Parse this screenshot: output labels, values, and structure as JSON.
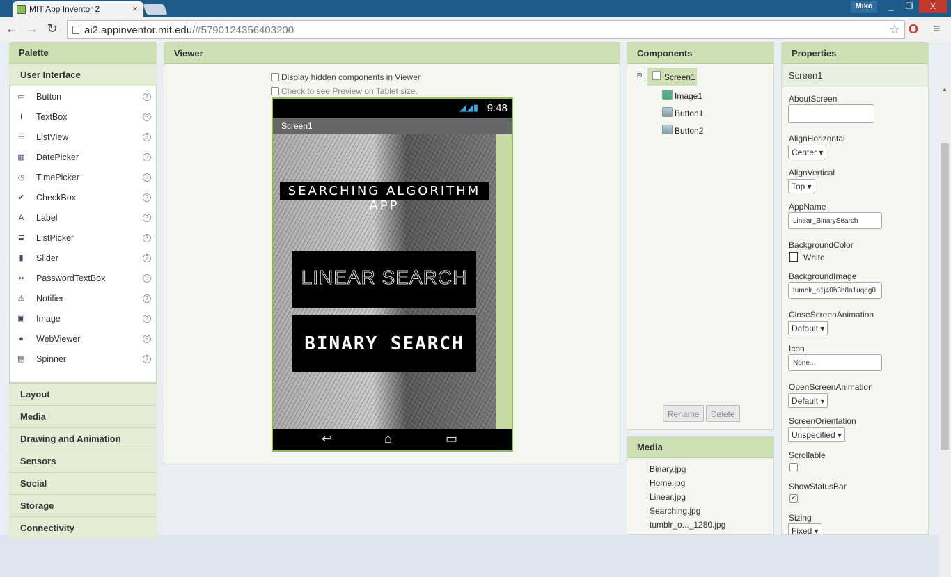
{
  "browser": {
    "tab_title": "MIT App Inventor 2",
    "tab_close": "×",
    "user": "Miko",
    "minimize": "_",
    "restore": "❐",
    "close": "X",
    "url_host": "ai2.appinventor.mit.edu",
    "url_path": "/#5790124356403200"
  },
  "palette": {
    "title": "Palette",
    "active_category": "User Interface",
    "items": [
      {
        "label": "Button",
        "icon": "button-icon",
        "glyph": "▭"
      },
      {
        "label": "TextBox",
        "icon": "textbox-icon",
        "glyph": "I"
      },
      {
        "label": "ListView",
        "icon": "listview-icon",
        "glyph": "☰"
      },
      {
        "label": "DatePicker",
        "icon": "datepicker-icon",
        "glyph": "▦"
      },
      {
        "label": "TimePicker",
        "icon": "timepicker-icon",
        "glyph": "◷"
      },
      {
        "label": "CheckBox",
        "icon": "checkbox-icon",
        "glyph": "✔"
      },
      {
        "label": "Label",
        "icon": "label-icon",
        "glyph": "A"
      },
      {
        "label": "ListPicker",
        "icon": "listpicker-icon",
        "glyph": "≣"
      },
      {
        "label": "Slider",
        "icon": "slider-icon",
        "glyph": "▮"
      },
      {
        "label": "PasswordTextBox",
        "icon": "password-icon",
        "glyph": "••"
      },
      {
        "label": "Notifier",
        "icon": "notifier-icon",
        "glyph": "⚠"
      },
      {
        "label": "Image",
        "icon": "image-icon",
        "glyph": "▣"
      },
      {
        "label": "WebViewer",
        "icon": "webviewer-icon",
        "glyph": "●"
      },
      {
        "label": "Spinner",
        "icon": "spinner-icon",
        "glyph": "▤"
      }
    ],
    "help": "?",
    "categories": [
      "Layout",
      "Media",
      "Drawing and Animation",
      "Sensors",
      "Social",
      "Storage",
      "Connectivity"
    ]
  },
  "viewer": {
    "title": "Viewer",
    "hidden_label": "Display hidden components in Viewer",
    "tablet_label": "Check to see Preview on Tablet size.",
    "phone": {
      "time": "9:48",
      "screen_title": "Screen1",
      "app_title": "SEARCHING ALGORITHM APP",
      "button1": "LINEAR SEARCH",
      "button2": "BINARY SEARCH",
      "nav_back": "↩",
      "nav_home": "⌂",
      "nav_recent": "▭"
    }
  },
  "components": {
    "title": "Components",
    "toggle": "⊟",
    "root": "Screen1",
    "children": [
      "Image1",
      "Button1",
      "Button2"
    ],
    "rename": "Rename",
    "delete": "Delete"
  },
  "media": {
    "title": "Media",
    "files": [
      "Binary.jpg",
      "Home.jpg",
      "Linear.jpg",
      "Searching.jpg",
      "tumblr_o..._1280.jpg"
    ]
  },
  "properties": {
    "title": "Properties",
    "component": "Screen1",
    "about_label": "AboutScreen",
    "about_value": "",
    "align_h_label": "AlignHorizontal",
    "align_h_value": "Center ▾",
    "align_v_label": "AlignVertical",
    "align_v_value": "Top ▾",
    "appname_label": "AppName",
    "appname_value": "Linear_BinarySearch",
    "bgcolor_label": "BackgroundColor",
    "bgcolor_value": "White",
    "bgimage_label": "BackgroundImage",
    "bgimage_value": "tumblr_o1j40h3h8n1uqeg0",
    "closeanim_label": "CloseScreenAnimation",
    "closeanim_value": "Default ▾",
    "icon_label": "Icon",
    "icon_value": "None...",
    "openanim_label": "OpenScreenAnimation",
    "openanim_value": "Default ▾",
    "orientation_label": "ScreenOrientation",
    "orientation_value": "Unspecified ▾",
    "scrollable_label": "Scrollable",
    "scrollable": false,
    "statusbar_label": "ShowStatusBar",
    "statusbar": true,
    "checkmark": "✔",
    "sizing_label": "Sizing",
    "sizing_value": "Fixed ▾"
  },
  "colors": {
    "panel_header": "#cde0b4",
    "phone_border": "#8bc34a",
    "chrome_bar": "#1f5b88"
  }
}
